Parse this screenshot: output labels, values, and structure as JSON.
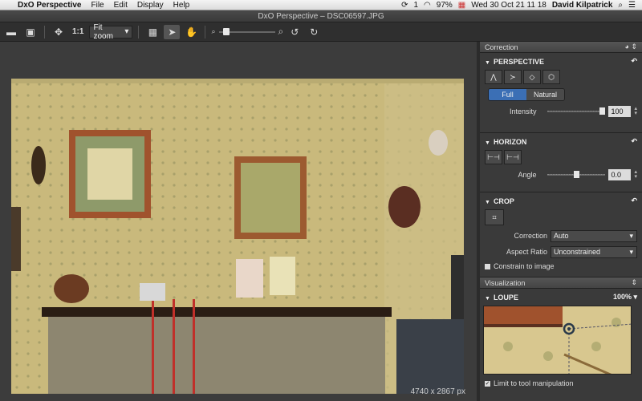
{
  "menubar": {
    "app": "DxO Perspective",
    "items": [
      "File",
      "Edit",
      "Display",
      "Help"
    ],
    "status": {
      "battery": "97%",
      "datetime": "Wed 30 Oct  21 11 18",
      "user": "David Kilpatrick",
      "badge": "1"
    }
  },
  "window": {
    "title": "DxO Perspective – DSC06597.JPG"
  },
  "toolbar": {
    "zoom_ratio": "1:1",
    "zoom_mode": "Fit zoom",
    "zoom_level": 0.08
  },
  "viewer": {
    "dimensions": "4740 x 2867 px"
  },
  "panel": {
    "header": "Correction",
    "perspective": {
      "title": "PERSPECTIVE",
      "modes": [
        "Full",
        "Natural"
      ],
      "active_mode": "Full",
      "intensity_label": "Intensity",
      "intensity_value": "100",
      "intensity_level": 1.0
    },
    "horizon": {
      "title": "HORIZON",
      "angle_label": "Angle",
      "angle_value": "0.0",
      "angle_level": 0.5
    },
    "crop": {
      "title": "CROP",
      "correction_label": "Correction",
      "correction_value": "Auto",
      "aspect_label": "Aspect Ratio",
      "aspect_value": "Unconstrained",
      "constrain_label": "Constrain to image"
    },
    "visualization": {
      "header": "Visualization",
      "loupe_title": "LOUPE",
      "loupe_zoom": "100%",
      "limit_label": "Limit to tool manipulation"
    }
  }
}
